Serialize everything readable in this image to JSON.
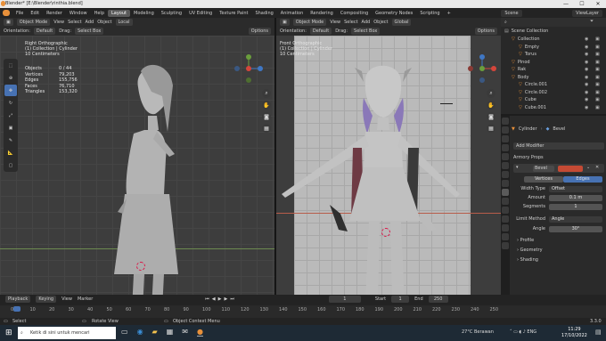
{
  "window": {
    "title": "Blender* [E:\\Blender\\rinthia.blend]",
    "minimize": "—",
    "maximize": "☐",
    "close": "✕"
  },
  "menus": [
    "File",
    "Edit",
    "Render",
    "Window",
    "Help"
  ],
  "workspaces": [
    "Layout",
    "Modeling",
    "Sculpting",
    "UV Editing",
    "Texture Paint",
    "Shading",
    "Animation",
    "Rendering",
    "Compositing",
    "Geometry Nodes",
    "Scripting"
  ],
  "scene": "Scene",
  "viewlayer": "ViewLayer",
  "left_viewport": {
    "mode": "Object Mode",
    "view": "View",
    "select": "Select",
    "add": "Add",
    "object": "Object",
    "orientation_label": "Orientation:",
    "orientation": "Default",
    "drag_label": "Drag:",
    "drag": "Select Box",
    "transform": "Local",
    "options": "Options",
    "overlay_title": "Right Orthographic",
    "overlay_sub1": "(1) Collection | Cylinder",
    "overlay_sub2": "10 Centimeters",
    "stats": [
      [
        "Objects",
        "0 / 44"
      ],
      [
        "Vertices",
        "79,203"
      ],
      [
        "Edges",
        "155,756"
      ],
      [
        "Faces",
        "76,710"
      ],
      [
        "Triangles",
        "153,320"
      ]
    ]
  },
  "right_viewport": {
    "mode": "Object Mode",
    "view": "View",
    "select": "Select",
    "add": "Add",
    "object": "Object",
    "transform": "Global",
    "orientation_label": "Orientation:",
    "orientation": "Default",
    "drag_label": "Drag:",
    "drag": "Select Box",
    "options": "Options",
    "overlay_title": "Front Orthographic",
    "overlay_sub1": "(1) Collection | Cylinder",
    "overlay_sub2": "10 Centimeters"
  },
  "outliner": {
    "title": "Scene Collection",
    "items": [
      {
        "label": "Collection",
        "depth": 1
      },
      {
        "label": "Empty",
        "depth": 2
      },
      {
        "label": "Torus",
        "depth": 2
      },
      {
        "label": "Pinod",
        "depth": 1
      },
      {
        "label": "Rak",
        "depth": 1
      },
      {
        "label": "Body",
        "depth": 1
      },
      {
        "label": "Circle.001",
        "depth": 2
      },
      {
        "label": "Circle.002",
        "depth": 2
      },
      {
        "label": "Cube",
        "depth": 2
      },
      {
        "label": "Cube.001",
        "depth": 2
      }
    ]
  },
  "properties": {
    "object": "Cylinder",
    "modifier_name": "Bevel",
    "add_modifier": "Add Modifier",
    "armory": "Armory Props",
    "mod_label": "Bevel",
    "tab_vertices": "Vertices",
    "tab_edges": "Edges",
    "width_type_label": "Width Type",
    "width_type": "Offset",
    "amount_label": "Amount",
    "amount": "0.1 m",
    "segments_label": "Segments",
    "segments": "1",
    "limit_label": "Limit Method",
    "limit": "Angle",
    "angle_label": "Angle",
    "angle": "30°",
    "sections": [
      "Profile",
      "Geometry",
      "Shading"
    ]
  },
  "timeline": {
    "playback": "Playback",
    "keying": "Keying",
    "view": "View",
    "marker": "Marker",
    "current": "1",
    "start_label": "Start",
    "start": "1",
    "end_label": "End",
    "end": "250",
    "ticks": [
      "0",
      "10",
      "20",
      "30",
      "40",
      "50",
      "60",
      "70",
      "80",
      "90",
      "100",
      "110",
      "120",
      "130",
      "140",
      "150",
      "160",
      "170",
      "180",
      "190",
      "200",
      "210",
      "220",
      "230",
      "240",
      "250"
    ]
  },
  "statusbar": {
    "select": "Select",
    "rotate": "Rotate View",
    "context": "Object Context Menu",
    "version": "3.3.0"
  },
  "taskbar": {
    "search": "Ketik di sini untuk mencari",
    "weather": "27°C Berawan",
    "time": "11:29",
    "date": "17/10/2022"
  },
  "colors": {
    "accent": "#4772b3",
    "orange": "#e8903a",
    "viewport_bg": "#3d3d3d",
    "front_bg": "#b8b8b8"
  }
}
